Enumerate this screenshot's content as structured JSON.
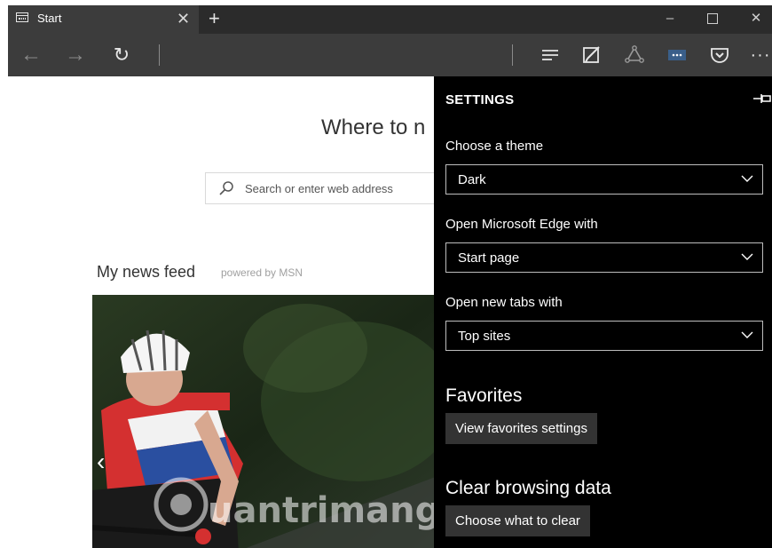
{
  "tab": {
    "title": "Start",
    "close_icon": "close-icon",
    "new_tab_icon": "plus-icon"
  },
  "window_controls": {
    "minimize": "–",
    "close": "✕"
  },
  "nav": {
    "back": "←",
    "forward": "→",
    "refresh": "↻",
    "more": "···"
  },
  "page": {
    "heading": "Where to n",
    "search_placeholder": "Search or enter web address",
    "feed_title": "My news feed",
    "feed_powered": "powered by MSN",
    "prev_icon": "‹",
    "watermark": "uantrimang"
  },
  "settings": {
    "title": "SETTINGS",
    "theme_label": "Choose a theme",
    "theme_value": "Dark",
    "open_with_label": "Open Microsoft Edge with",
    "open_with_value": "Start page",
    "new_tabs_label": "Open new tabs with",
    "new_tabs_value": "Top sites",
    "favorites_title": "Favorites",
    "favorites_button": "View favorites settings",
    "clear_title": "Clear browsing data",
    "clear_button": "Choose what to clear"
  },
  "colors": {
    "titlebar": "#2b2b2b",
    "navbar": "#3c3c3c",
    "settings_bg": "#000000",
    "button_bg": "#333333"
  }
}
